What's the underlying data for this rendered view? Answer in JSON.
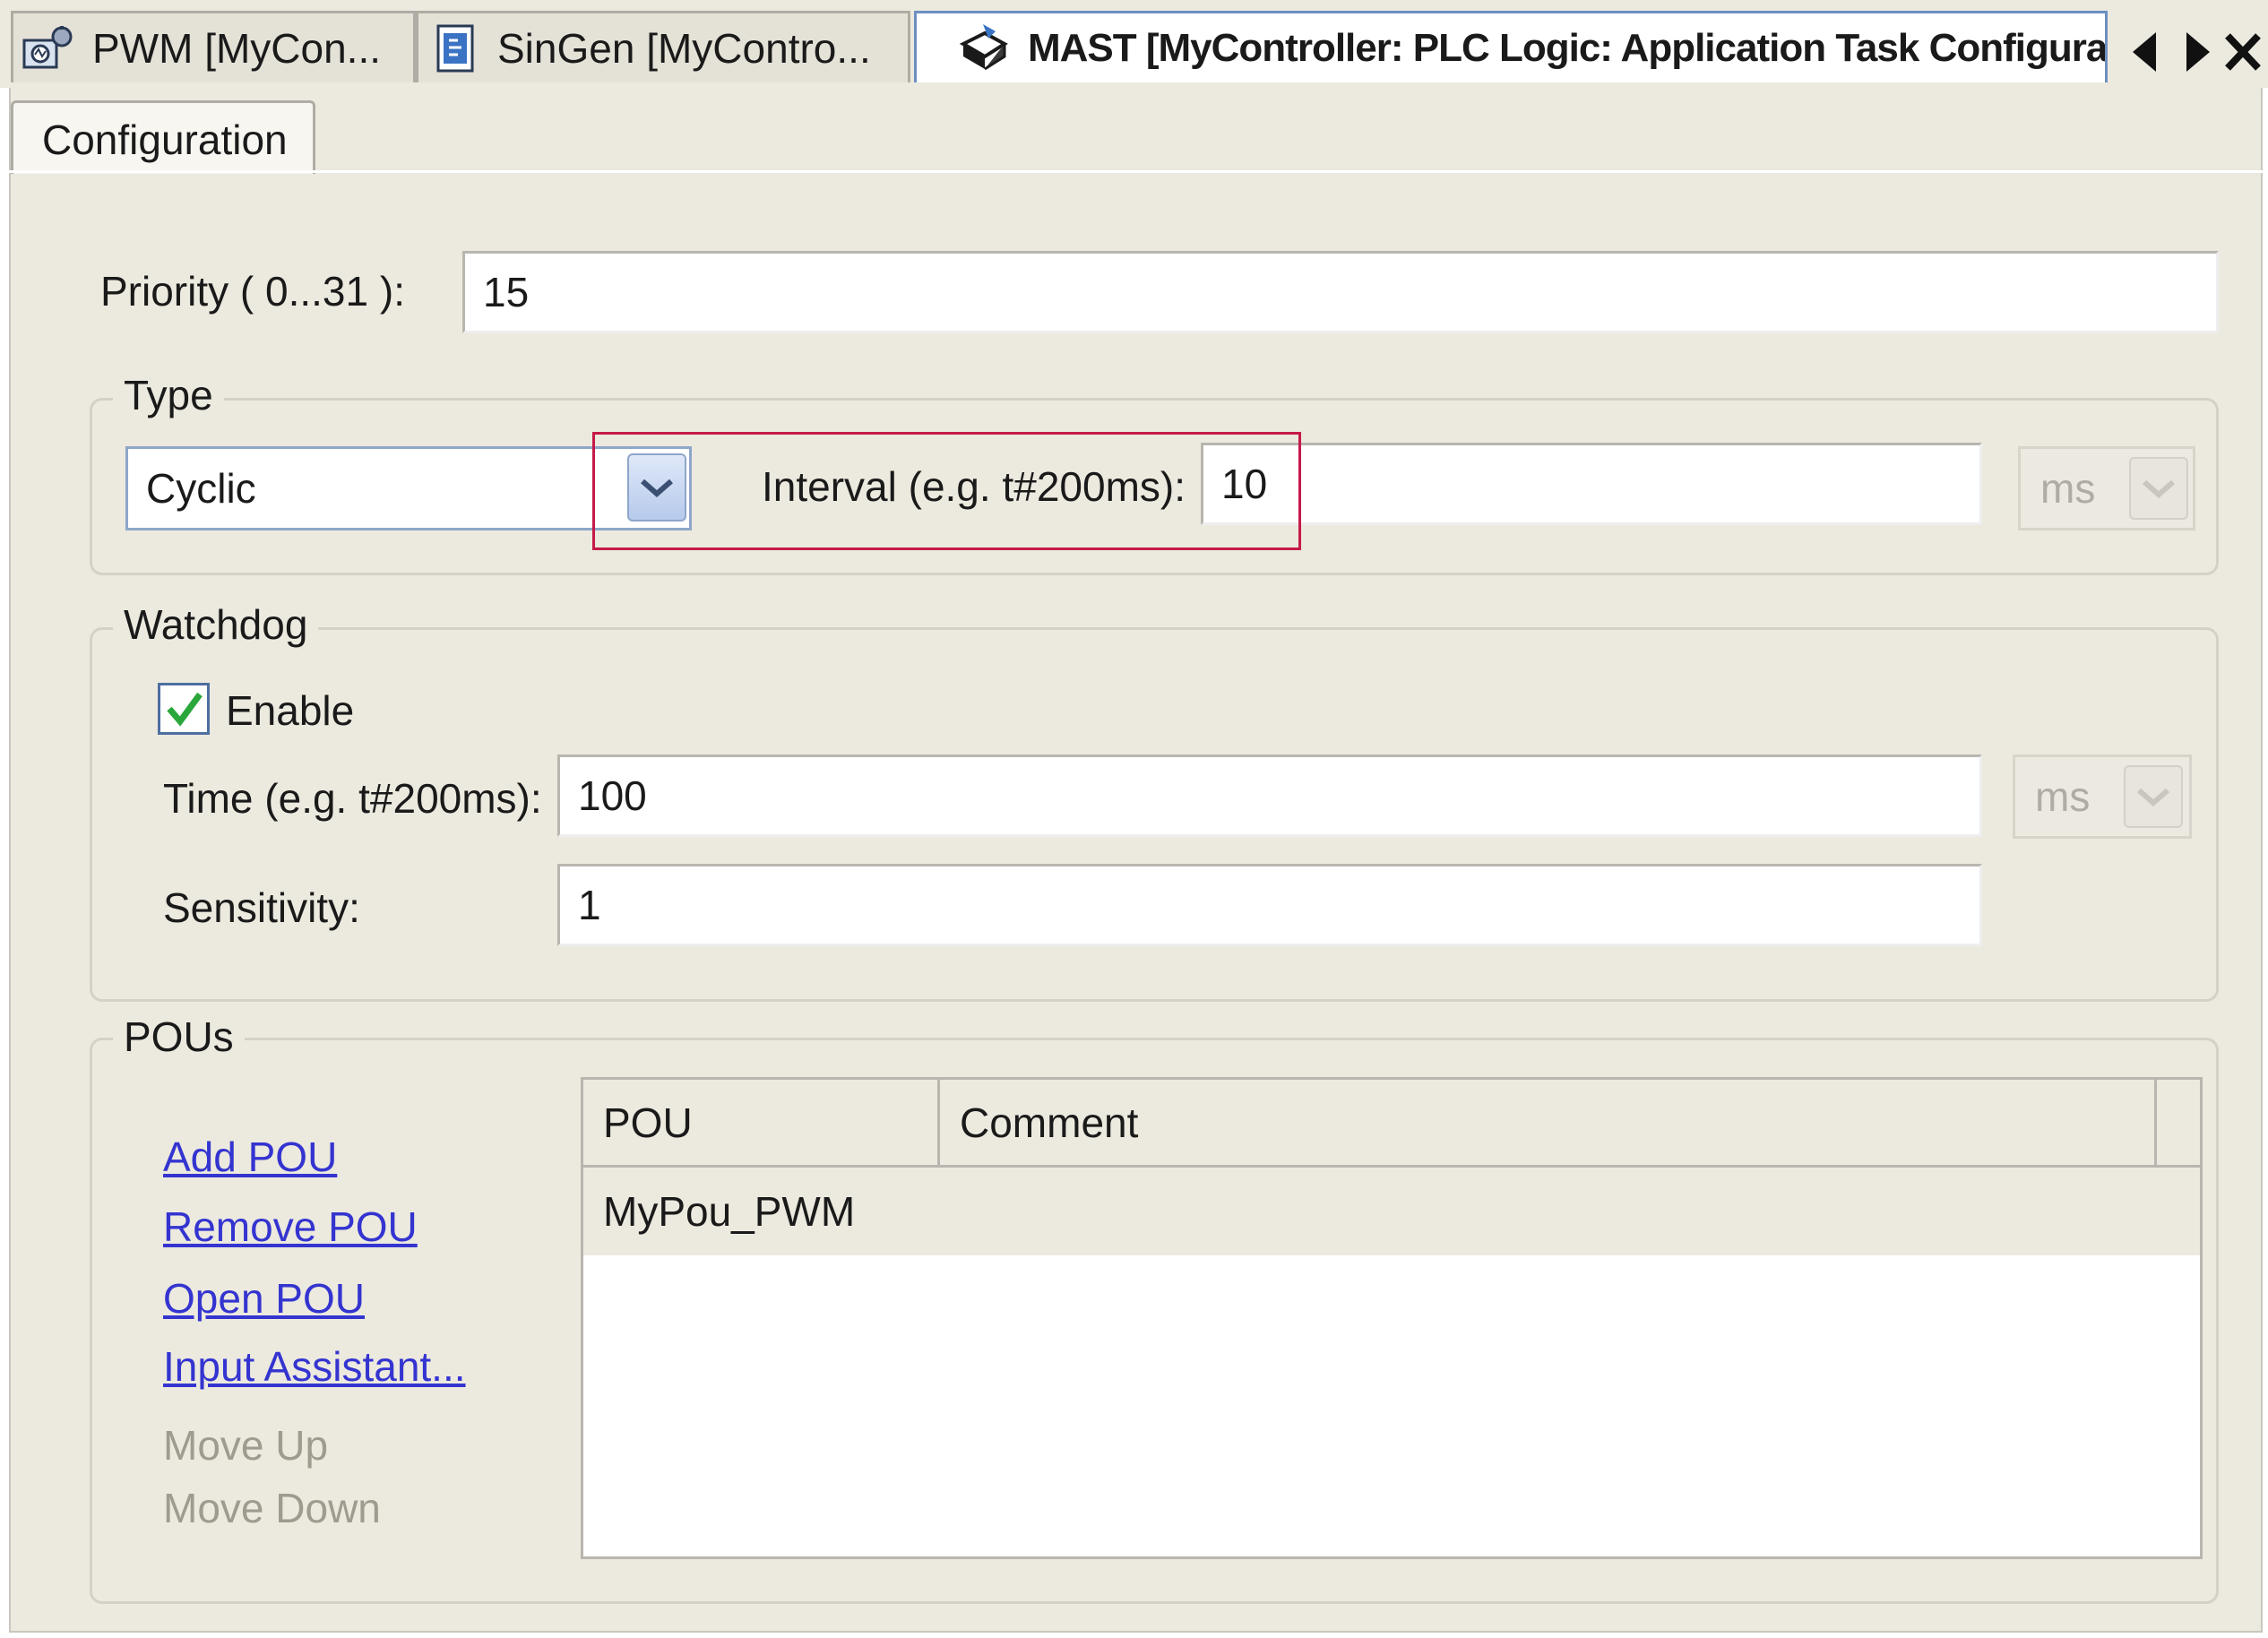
{
  "tabs": [
    {
      "label": "PWM [MyCon...",
      "icon": "pwm-monitor-icon",
      "active": false
    },
    {
      "label": "SinGen [MyContro...",
      "icon": "program-file-icon",
      "active": false
    },
    {
      "label": "MAST [MyController: PLC Logic: Application Task Configuration]",
      "icon": "task-cube-icon",
      "active": true
    }
  ],
  "subtab": {
    "label": "Configuration"
  },
  "priority": {
    "label": "Priority ( 0...31 ):",
    "value": "15"
  },
  "type_group": {
    "title": "Type",
    "type_value": "Cyclic",
    "interval_label": "Interval (e.g. t#200ms):",
    "interval_value": "10",
    "unit": "ms"
  },
  "watchdog": {
    "title": "Watchdog",
    "enable_label": "Enable",
    "enabled": true,
    "time_label": "Time (e.g. t#200ms):",
    "time_value": "100",
    "time_unit": "ms",
    "sensitivity_label": "Sensitivity:",
    "sensitivity_value": "1"
  },
  "pous": {
    "title": "POUs",
    "links": {
      "add": "Add POU",
      "remove": "Remove POU",
      "open": "Open POU",
      "assistant": "Input Assistant..."
    },
    "move_up": "Move Up",
    "move_down": "Move Down",
    "columns": [
      "POU",
      "Comment"
    ],
    "rows": [
      {
        "pou": "MyPou_PWM",
        "comment": ""
      }
    ]
  },
  "colors": {
    "background": "#ece9df",
    "link": "#3434d0",
    "highlight": "#c51a4a",
    "active_tab_border": "#6d8fc2",
    "check": "#2aa63a"
  }
}
